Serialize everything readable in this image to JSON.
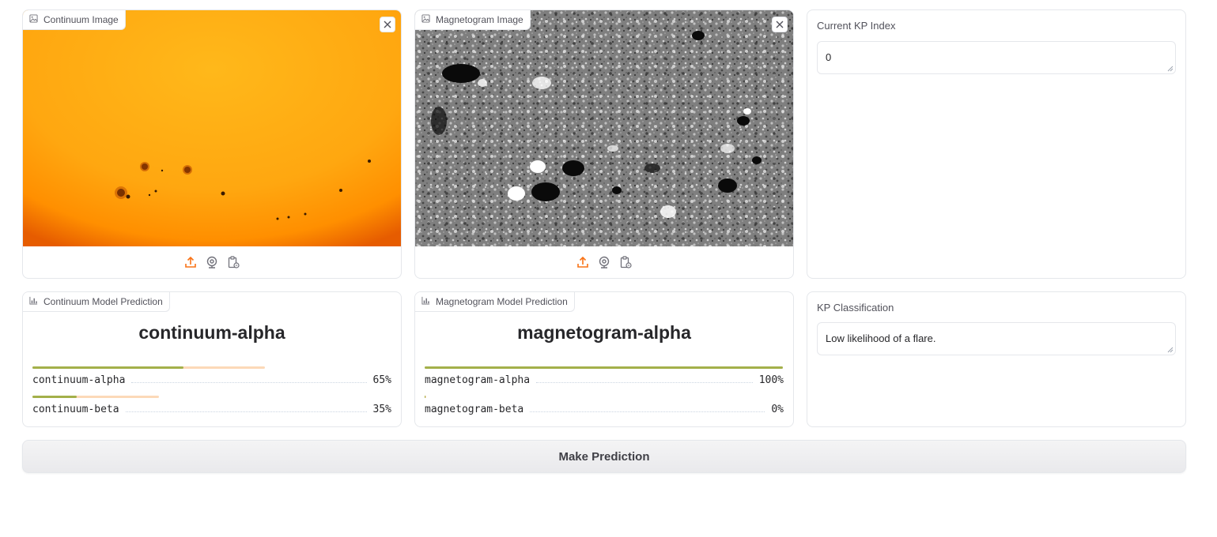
{
  "continuum_input": {
    "label": "Continuum Image",
    "image_icon": "image-icon",
    "close_icon": "close-icon",
    "tools": [
      "upload-icon",
      "webcam-icon",
      "clipboard-icon"
    ]
  },
  "magnetogram_input": {
    "label": "Magnetogram Image",
    "image_icon": "image-icon",
    "close_icon": "close-icon",
    "tools": [
      "upload-icon",
      "webcam-icon",
      "clipboard-icon"
    ]
  },
  "kp_index": {
    "label": "Current KP Index",
    "value": "0"
  },
  "continuum_prediction": {
    "label": "Continuum Model Prediction",
    "icon": "bar-chart-icon",
    "top_label": "continuum-alpha",
    "confidences": [
      {
        "label": "continuum-alpha",
        "percent": "65%",
        "fraction": 0.65
      },
      {
        "label": "continuum-beta",
        "percent": "35%",
        "fraction": 0.35
      }
    ]
  },
  "magnetogram_prediction": {
    "label": "Magnetogram Model Prediction",
    "icon": "bar-chart-icon",
    "top_label": "magnetogram-alpha",
    "confidences": [
      {
        "label": "magnetogram-alpha",
        "percent": "100%",
        "fraction": 1.0
      },
      {
        "label": "magnetogram-beta",
        "percent": "0%",
        "fraction": 0.0
      }
    ]
  },
  "kp_classification": {
    "label": "KP Classification",
    "value": "Low likelihood of a flare."
  },
  "predict_button": {
    "label": "Make Prediction"
  },
  "colors": {
    "accent": "#f97316",
    "bar_fill": "#a3b04a",
    "bar_track": "#fcd9b8",
    "continuum_bg": "#ffa800",
    "magnetogram_bg": "#7a7a7a"
  }
}
